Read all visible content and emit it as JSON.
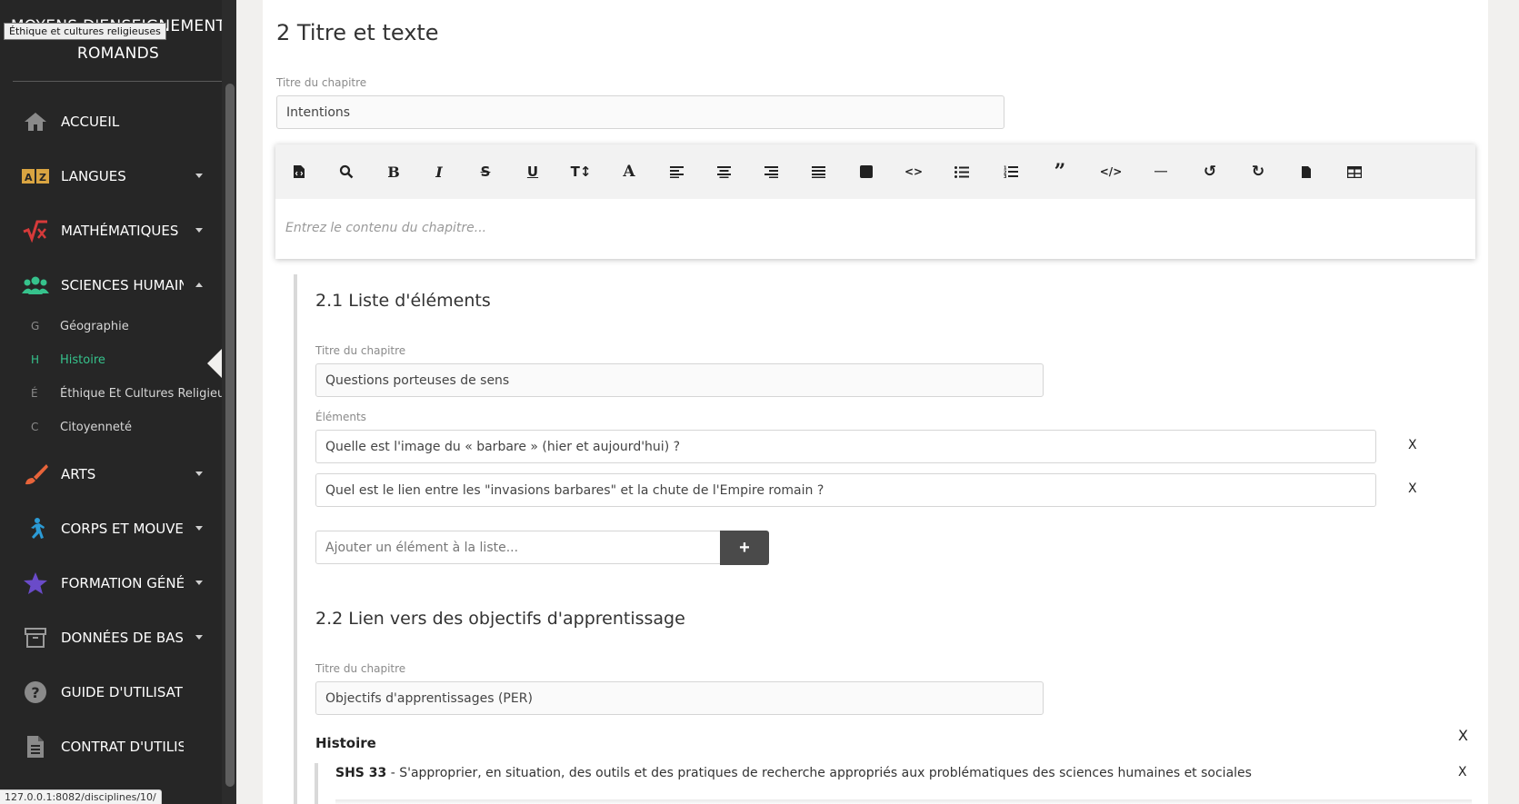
{
  "sidebar": {
    "brand_line1": "MOYENS D'ENSEIGNEMENT",
    "brand_line2": "ROMANDS",
    "tooltip": "Éthique et cultures religieuses",
    "items": [
      {
        "label": "ACCUEIL",
        "icon": "home-icon"
      },
      {
        "label": "LANGUES",
        "icon": "languages-icon"
      },
      {
        "label": "MATHÉMATIQUES ET SCIENCES",
        "icon": "math-icon"
      },
      {
        "label": "SCIENCES HUMAINES ET SOCIALES",
        "icon": "people-icon"
      },
      {
        "label": "ARTS",
        "icon": "brush-icon"
      },
      {
        "label": "CORPS ET MOUVEMENT",
        "icon": "running-icon"
      },
      {
        "label": "FORMATION GÉNÉRALE",
        "icon": "star-icon"
      },
      {
        "label": "DONNÉES DE BASE",
        "icon": "archive-icon"
      },
      {
        "label": "GUIDE D'UTILISATION",
        "icon": "question-icon"
      },
      {
        "label": "CONTRAT D'UTILISATION",
        "icon": "document-icon"
      }
    ],
    "subitems": [
      {
        "letter": "G",
        "label": "Géographie"
      },
      {
        "letter": "H",
        "label": "Histoire"
      },
      {
        "letter": "É",
        "label": "Éthique Et Cultures Religieuses"
      },
      {
        "letter": "C",
        "label": "Citoyenneté"
      }
    ],
    "status_url": "127.0.0.1:8082/disciplines/10/",
    "colors": {
      "accent": "#36c28c",
      "background": "#262626"
    }
  },
  "main": {
    "section_title": "2 Titre et texte",
    "chapter_label": "Titre du chapitre",
    "chapter_value": "Intentions",
    "editor_placeholder": "Entrez le contenu du chapitre...",
    "list_section": {
      "title": "2.1 Liste d'éléments",
      "chapter_label": "Titre du chapitre",
      "chapter_value": "Questions porteuses de sens",
      "elements_label": "Éléments",
      "elements": [
        "Quelle est l'image du « barbare » (hier et aujourd'hui) ?",
        "Quel est le lien entre les \"invasions barbares\" et la chute de l'Empire romain ?"
      ],
      "remove_label": "X",
      "add_placeholder": "Ajouter un élément à la liste...",
      "add_button": "+"
    },
    "objectives_section": {
      "title": "2.2 Lien vers des objectifs d'apprentissage",
      "chapter_label": "Titre du chapitre",
      "chapter_value": "Objectifs d'apprentissages (PER)",
      "discipline": "Histoire",
      "remove_label": "X",
      "objective_code": "SHS 33",
      "objective_text": " - S'approprier, en situation, des outils et des pratiques de recherche appropriés aux problématiques des sciences humaines et sociales"
    }
  }
}
